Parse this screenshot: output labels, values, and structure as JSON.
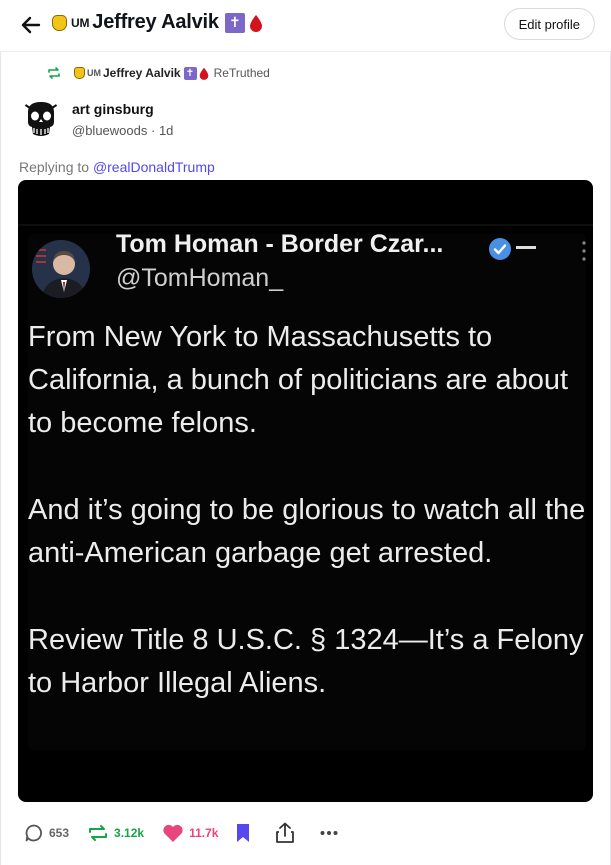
{
  "header": {
    "title": "Jeffrey Aalvik",
    "title_prefix_badge": "UM",
    "edit_button_label": "Edit profile"
  },
  "retruth": {
    "prefix_badge": "UM",
    "name": "Jeffrey Aalvik",
    "verb": "ReTruthed"
  },
  "post": {
    "author_name": "art ginsburg",
    "author_handle": "@bluewoods",
    "separator": "·",
    "age": "1d",
    "replying_prefix": "Replying to",
    "replying_to": "@realDonaldTrump"
  },
  "embedded_tweet": {
    "display_name": "Tom Homan - Border Czar...",
    "handle": "@TomHoman_",
    "paragraphs": [
      "From New York to Massachusetts to California, a bunch of politicians are about to become felons.",
      "And it’s going to be glorious to watch all the anti-American garbage get arrested.",
      "Review Title 8 U.S.C. § 1324—It’s a Felony to Harbor Illegal Aliens."
    ]
  },
  "actions": {
    "reply_count": "653",
    "retruth_count": "3.12k",
    "like_count": "11.7k"
  },
  "icons": [
    "back-arrow-icon",
    "fist-icon",
    "cross-icon",
    "blood-drop-icon",
    "retruth-icon",
    "reply-icon",
    "heart-icon",
    "bookmark-icon",
    "share-icon",
    "more-icon",
    "verified-icon"
  ],
  "colors": {
    "accent": "#5448ee",
    "retruth_green": "#17a34a",
    "like_pink": "#e8457a",
    "bookmark_purple": "#5448ee",
    "cross_purple": "#7b68c9",
    "drop_red": "#d4141c"
  }
}
